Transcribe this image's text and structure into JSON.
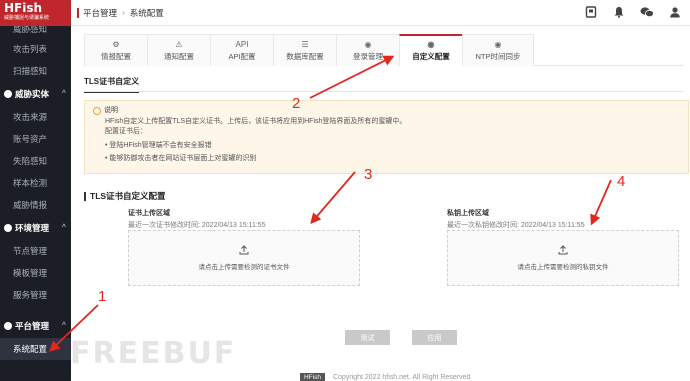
{
  "app": {
    "brand": "HFish",
    "tagline": "威胁捕捉与诱骗系统"
  },
  "sidebar": {
    "items": [
      {
        "label": "威胁感知",
        "type": "section-partial"
      },
      {
        "label": "攻击列表",
        "type": "item"
      },
      {
        "label": "扫描感知",
        "type": "item"
      },
      {
        "label": "威胁实体",
        "type": "section"
      },
      {
        "label": "攻击来源",
        "type": "item"
      },
      {
        "label": "账号资产",
        "type": "item"
      },
      {
        "label": "失陷感知",
        "type": "item"
      },
      {
        "label": "样本检测",
        "type": "item"
      },
      {
        "label": "威胁情报",
        "type": "item"
      },
      {
        "label": "环境管理",
        "type": "section"
      },
      {
        "label": "节点管理",
        "type": "item"
      },
      {
        "label": "模板管理",
        "type": "item"
      },
      {
        "label": "服务管理",
        "type": "item"
      },
      {
        "label": "平台管理",
        "type": "section"
      },
      {
        "label": "系统配置",
        "type": "item-active"
      }
    ]
  },
  "header": {
    "breadcrumb": [
      "平台管理",
      "系统配置"
    ],
    "icons": [
      "book-icon",
      "bell-icon",
      "wechat-icon",
      "user-icon"
    ]
  },
  "tabs": [
    {
      "label": "情报配置",
      "icon": "⚙"
    },
    {
      "label": "通知配置",
      "icon": "⚠"
    },
    {
      "label": "API配置",
      "icon": "API"
    },
    {
      "label": "数据库配置",
      "icon": "☰"
    },
    {
      "label": "登录管理",
      "icon": "◉"
    },
    {
      "label": "自定义配置",
      "icon": "◉",
      "active": true
    },
    {
      "label": "NTP时间同步",
      "icon": "◉"
    }
  ],
  "subtab": {
    "label": "TLS证书自定义"
  },
  "notice": {
    "title": "说明",
    "line1": "HFish自定义上传配置TLS自定义证书。上传后，该证书将应用到HFish登陆界面及所有的蜜罐中。",
    "line2": "配置证书后：",
    "bullet1": "• 登陆HFish管理端不会有安全报错",
    "bullet2": "• 能够防御攻击者在网站证书层面上对蜜罐的识别"
  },
  "section": {
    "title": "TLS证书自定义配置"
  },
  "cert_upload": {
    "label": "证书上传区域",
    "time": "最近一次证书修改时间: 2022/04/13 15:11:55",
    "prompt": "请点击上传需要检测的证书文件"
  },
  "key_upload": {
    "label": "私钥上传区域",
    "time": "最近一次私钥修改时间: 2022/04/13 15:11:55",
    "prompt": "请点击上传需要检测的私钥文件"
  },
  "buttons": {
    "test": "测试",
    "apply": "应用"
  },
  "footer": {
    "brand": "HFish",
    "copyright": "Copyright 2022 hfish.net. All Right Reserved"
  },
  "annotations": [
    "1",
    "2",
    "3",
    "4"
  ],
  "watermark": "FREEBUF",
  "colors": {
    "accent": "#c0272d",
    "sidebar": "#1c1e26",
    "arrow": "#e0281f",
    "notice_bg": "#fdf6e9"
  }
}
